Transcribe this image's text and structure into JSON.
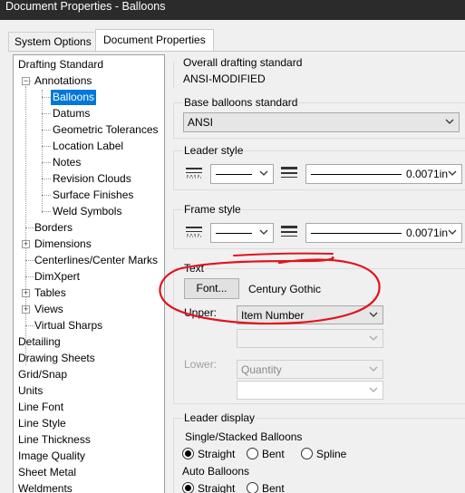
{
  "window": {
    "title": "Document Properties - Balloons"
  },
  "tabs": [
    {
      "label": "System Options"
    },
    {
      "label": "Document Properties"
    }
  ],
  "tree": {
    "items": [
      {
        "label": "Drafting Standard"
      },
      {
        "label": "Annotations"
      },
      {
        "label": "Balloons"
      },
      {
        "label": "Datums"
      },
      {
        "label": "Geometric Tolerances"
      },
      {
        "label": "Location Label"
      },
      {
        "label": "Notes"
      },
      {
        "label": "Revision Clouds"
      },
      {
        "label": "Surface Finishes"
      },
      {
        "label": "Weld Symbols"
      },
      {
        "label": "Borders"
      },
      {
        "label": "Dimensions"
      },
      {
        "label": "Centerlines/Center Marks"
      },
      {
        "label": "DimXpert"
      },
      {
        "label": "Tables"
      },
      {
        "label": "Views"
      },
      {
        "label": "Virtual Sharps"
      },
      {
        "label": "Detailing"
      },
      {
        "label": "Drawing Sheets"
      },
      {
        "label": "Grid/Snap"
      },
      {
        "label": "Units"
      },
      {
        "label": "Line Font"
      },
      {
        "label": "Line Style"
      },
      {
        "label": "Line Thickness"
      },
      {
        "label": "Image Quality"
      },
      {
        "label": "Sheet Metal"
      },
      {
        "label": "Weldments"
      }
    ]
  },
  "overall": {
    "title": "Overall drafting standard",
    "value": "ANSI-MODIFIED"
  },
  "base_balloons": {
    "title": "Base balloons standard",
    "value": "ANSI"
  },
  "leader_style": {
    "title": "Leader style",
    "thickness": "0.0071in"
  },
  "frame_style": {
    "title": "Frame style",
    "thickness": "0.0071in"
  },
  "text": {
    "title": "Text",
    "font_button": "Font...",
    "font_name": "Century Gothic",
    "upper_label": "Upper:",
    "upper_value": "Item Number",
    "lower_label": "Lower:",
    "lower_value": "Quantity"
  },
  "leader_display": {
    "title": "Leader display",
    "single_label": "Single/Stacked Balloons",
    "single_options": [
      {
        "label": "Straight",
        "selected": true
      },
      {
        "label": "Bent",
        "selected": false
      },
      {
        "label": "Spline",
        "selected": false
      }
    ],
    "auto_label": "Auto Balloons",
    "auto_options": [
      {
        "label": "Straight",
        "selected": true
      },
      {
        "label": "Bent",
        "selected": false
      }
    ]
  },
  "colors": {
    "selection": "#0078d7",
    "annotation": "#e0141e"
  }
}
